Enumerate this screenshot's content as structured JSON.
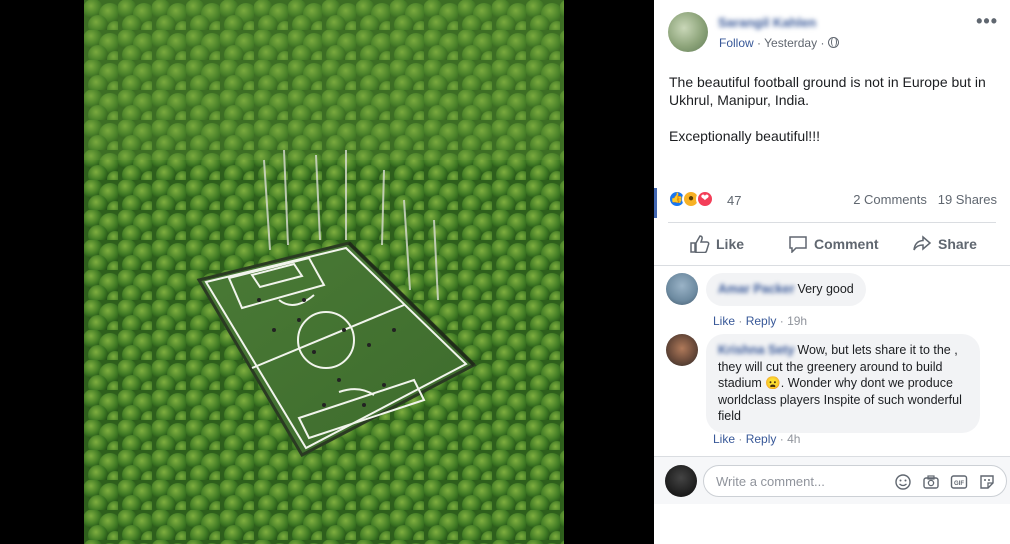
{
  "post": {
    "author": "Sarangil Kahlen",
    "follow_label": "Follow",
    "separator": "·",
    "time": "Yesterday",
    "more": "•••",
    "text_paragraphs": [
      "The beautiful football ground is not in Europe but in Ukhrul, Manipur, India.",
      "Exceptionally beautiful!!!"
    ],
    "privacy_icon": "globe-icon"
  },
  "reactions": {
    "icons": [
      "like-icon",
      "wow-icon",
      "love-icon"
    ],
    "count": "47",
    "comments": "2 Comments",
    "shares": "19 Shares"
  },
  "actions": {
    "like": "Like",
    "comment": "Comment",
    "share": "Share"
  },
  "comments": [
    {
      "author": "Amar Packer",
      "text": "Very good",
      "like": "Like",
      "reply": "Reply",
      "time": "19h"
    },
    {
      "author": "Krishna Sety",
      "text": "Wow, but lets share it to the , they will cut the greenery around to build stadium 😦. Wonder why dont we produce worldclass players Inspite of such wonderful field",
      "like": "Like",
      "reply": "Reply",
      "time": "4h"
    }
  ],
  "composer": {
    "placeholder": "Write a comment...",
    "icons": [
      "emoji-icon",
      "camera-icon",
      "gif-icon",
      "sticker-icon"
    ]
  },
  "colors": {
    "link": "#385898",
    "like_blue": "#1877f2",
    "love_red": "#f33e58",
    "wow_yellow": "#f7b125"
  }
}
